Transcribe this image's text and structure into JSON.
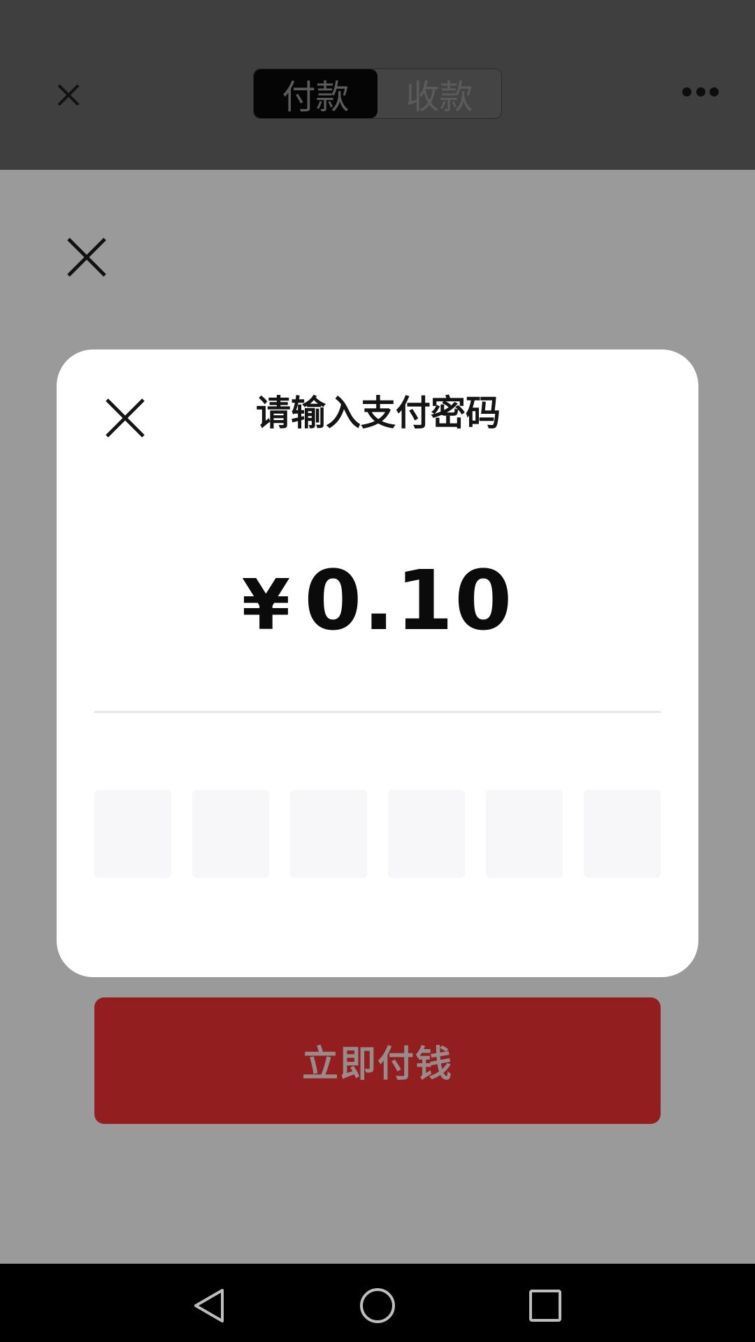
{
  "topbar": {
    "tabs": [
      {
        "label": "付款",
        "active": true
      },
      {
        "label": "收款",
        "active": false
      }
    ],
    "close_icon": "close-icon",
    "more_icon": "more-horizontal-icon"
  },
  "dialog": {
    "title": "请输入支付密码",
    "currency_symbol": "¥",
    "amount": "0.10",
    "pin_length": 6,
    "close_icon": "close-icon"
  },
  "pay_button": {
    "label": "立即付钱",
    "color": "#921e20"
  },
  "navbar": {
    "icons": [
      "back-triangle-icon",
      "home-circle-icon",
      "recent-square-icon"
    ]
  }
}
